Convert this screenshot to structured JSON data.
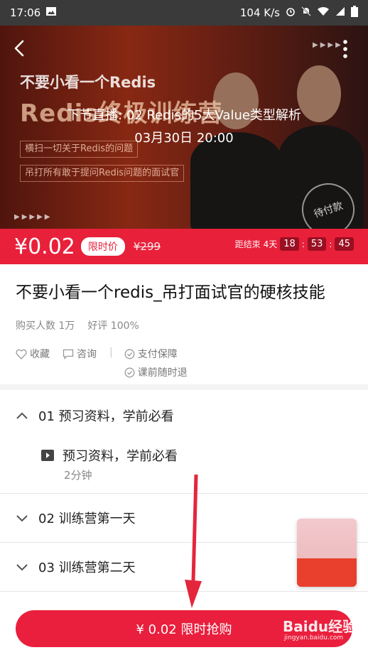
{
  "status_bar": {
    "time": "17:06",
    "network_speed": "104 K/s"
  },
  "hero": {
    "poster_line1": "不要小看一个Redis",
    "poster_line2": "Redis终极训练营",
    "poster_tag1": "横扫一切关于Redis的问题",
    "poster_tag2": "吊打所有敢于提问Redis问题的面试官",
    "seal_text": "待付款",
    "next_live": "下节直播: 02 Redis的5大Value类型解析",
    "next_time": "03月30日 20:00"
  },
  "price_bar": {
    "price": "¥0.02",
    "limited_label": "限时价",
    "original_price": "¥299",
    "countdown_label": "距结束",
    "countdown_days": "4天",
    "countdown_h": "18",
    "countdown_m": "53",
    "countdown_s": "45"
  },
  "course": {
    "title": "不要小看一个redis_吊打面试官的硬核技能",
    "buyers": "购买人数 1万",
    "rating": "好评 100%"
  },
  "actions": {
    "favorite": "收藏",
    "consult": "咨询",
    "guarantee1": "支付保障",
    "guarantee2": "课前随时退"
  },
  "chapters": [
    {
      "label": "01 预习资料，学前必看",
      "expanded": true
    },
    {
      "label": "02 训练营第一天",
      "expanded": false
    },
    {
      "label": "03 训练营第二天",
      "expanded": false
    }
  ],
  "lesson": {
    "label": "预习资料，学前必看",
    "duration": "2分钟"
  },
  "buy_button": {
    "label": "¥ 0.02 限时抢购"
  },
  "watermark": {
    "text": "Baidu经验",
    "sub": "jingyan.baidu.com"
  },
  "colors": {
    "accent": "#e8203a",
    "status_bar": "#3a3a3a"
  }
}
